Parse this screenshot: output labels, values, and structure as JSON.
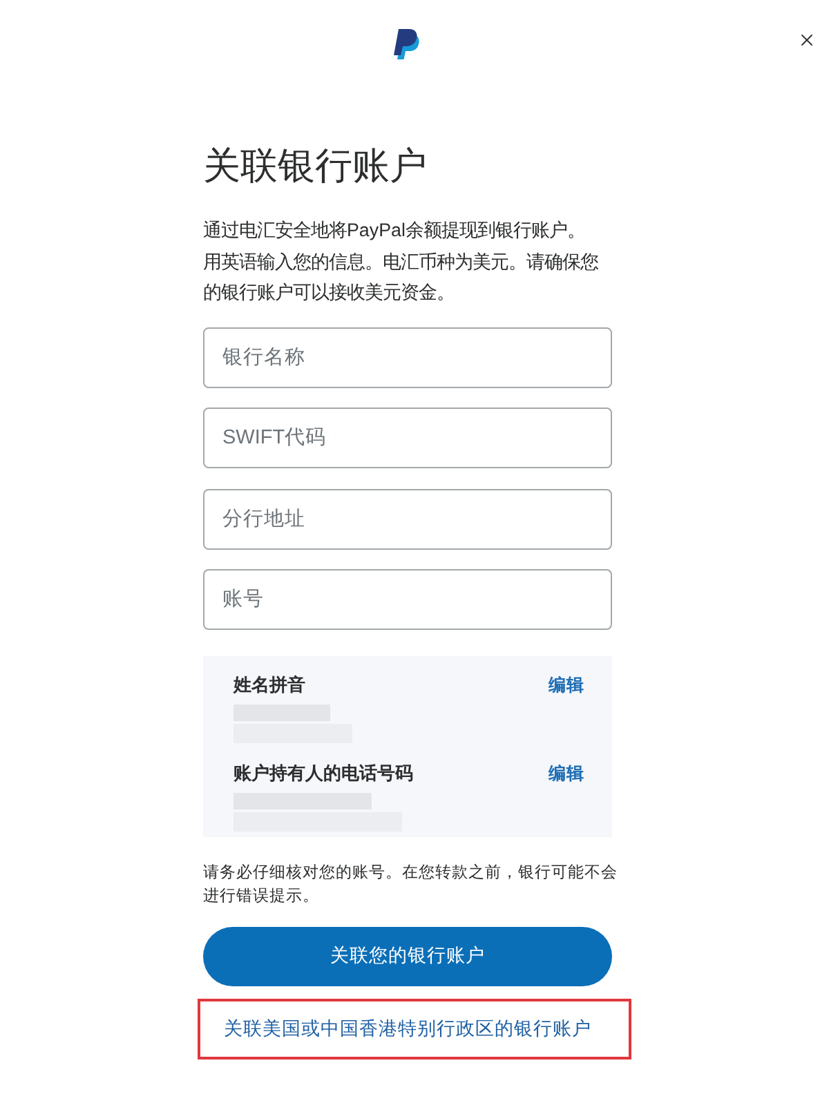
{
  "title": "关联银行账户",
  "description": [
    "通过电汇安全地将PayPal余额提现到银行账户。",
    "用英语输入您的信息。电汇币种为美元。请确保您的银行账户可以接收美元资金。"
  ],
  "fields": [
    {
      "placeholder": "银行名称"
    },
    {
      "placeholder": "SWIFT代码"
    },
    {
      "placeholder": "分行地址"
    },
    {
      "placeholder": "账号"
    }
  ],
  "holder_info": [
    {
      "label": "姓名拼音",
      "action": "编辑"
    },
    {
      "label": "账户持有人的电话号码",
      "action": "编辑"
    }
  ],
  "note": "请务必仔细核对您的账号。在您转款之前，银行可能不会进行错误提示。",
  "primary_button": "关联您的银行账户",
  "secondary_link": {
    "label": "关联美国或中国香港特别行政区的银行账户",
    "highlighted": true
  }
}
